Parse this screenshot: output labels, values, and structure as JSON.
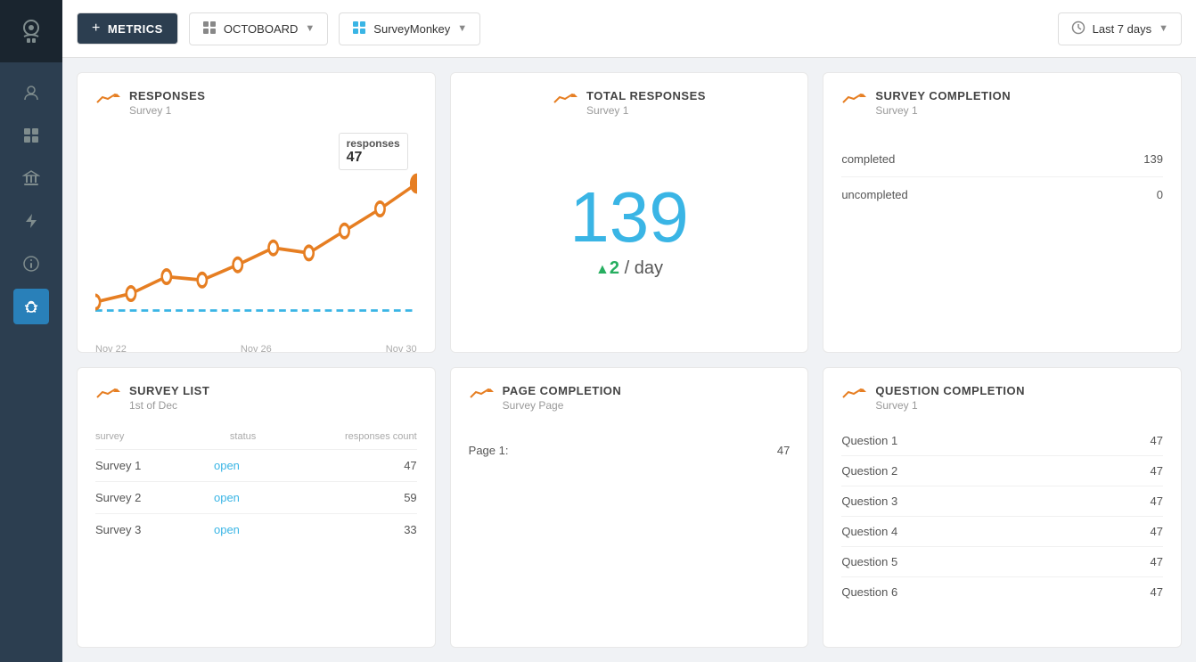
{
  "sidebar": {
    "logo_icon": "user-robot-icon",
    "items": [
      {
        "name": "sidebar-item-user",
        "icon": "👤",
        "active": false
      },
      {
        "name": "sidebar-item-dashboard",
        "icon": "⊞",
        "active": false
      },
      {
        "name": "sidebar-item-bank",
        "icon": "🏛",
        "active": false
      },
      {
        "name": "sidebar-item-lightning",
        "icon": "⚡",
        "active": false
      },
      {
        "name": "sidebar-item-info",
        "icon": "ℹ",
        "active": false
      },
      {
        "name": "sidebar-item-bug",
        "icon": "🐛",
        "active": true
      }
    ]
  },
  "topbar": {
    "add_label": "+",
    "metrics_label": "METRICS",
    "octoboard_label": "OCTOBOARD",
    "surveymonkey_label": "SurveyMonkey",
    "time_label": "Last 7 days"
  },
  "responses_card": {
    "title": "RESPONSES",
    "subtitle": "Survey 1",
    "tooltip_label": "responses",
    "tooltip_value": "47",
    "x_labels": [
      "Nov 22",
      "Nov 26",
      "Nov 30"
    ],
    "chart_data": [
      10,
      15,
      20,
      18,
      25,
      30,
      28,
      35,
      40,
      47
    ]
  },
  "total_responses_card": {
    "title": "TOTAL RESPONSES",
    "subtitle": "Survey 1",
    "big_number": "139",
    "per_day_number": "2",
    "per_day_label": "/ day"
  },
  "survey_completion_card": {
    "title": "SURVEY COMPLETION",
    "subtitle": "Survey 1",
    "rows": [
      {
        "label": "completed",
        "value": "139"
      },
      {
        "label": "uncompleted",
        "value": "0"
      }
    ]
  },
  "survey_list_card": {
    "title": "SURVEY LIST",
    "subtitle": "1st of Dec",
    "col_survey": "survey",
    "col_status": "status",
    "col_count": "responses count",
    "rows": [
      {
        "name": "Survey 1",
        "status": "open",
        "count": "47"
      },
      {
        "name": "Survey 2",
        "status": "open",
        "count": "59"
      },
      {
        "name": "Survey 3",
        "status": "open",
        "count": "33"
      }
    ]
  },
  "page_completion_card": {
    "title": "PAGE COMPLETION",
    "subtitle": "Survey Page",
    "rows": [
      {
        "label": "Page 1:",
        "value": "47"
      }
    ]
  },
  "question_completion_card": {
    "title": "QUESTION COMPLETION",
    "subtitle": "Survey 1",
    "rows": [
      {
        "label": "Question 1",
        "value": "47"
      },
      {
        "label": "Question 2",
        "value": "47"
      },
      {
        "label": "Question 3",
        "value": "47"
      },
      {
        "label": "Question 4",
        "value": "47"
      },
      {
        "label": "Question 5",
        "value": "47"
      },
      {
        "label": "Question 6",
        "value": "47"
      }
    ]
  },
  "colors": {
    "accent_blue": "#3ab5e5",
    "accent_orange": "#e67e22",
    "sidebar_bg": "#2c3e50",
    "card_bg": "#ffffff",
    "trend_icon": "#e67e22"
  }
}
